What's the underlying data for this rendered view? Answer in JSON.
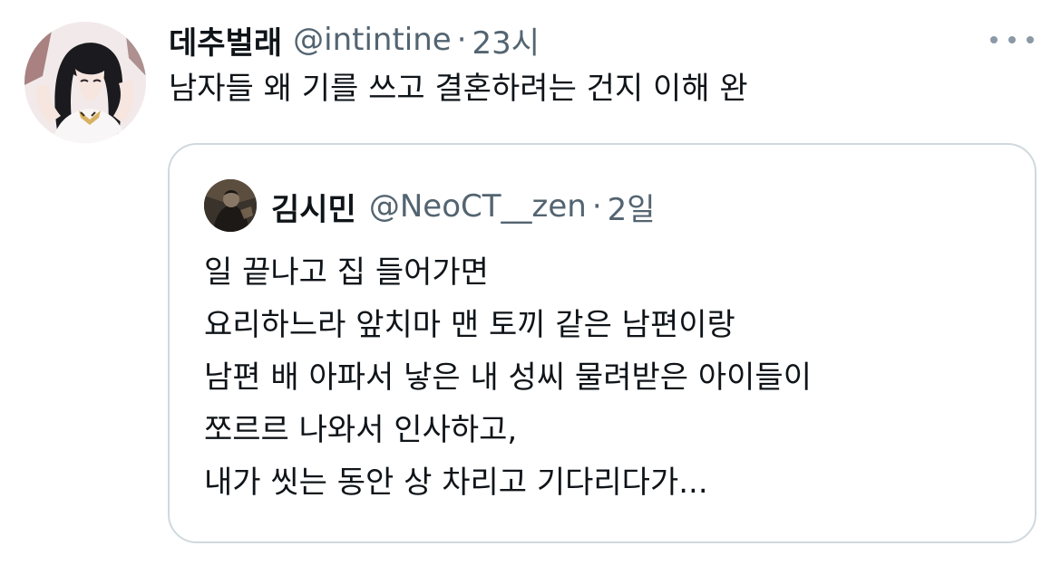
{
  "tweet": {
    "display_name": "데추벌래",
    "handle": "@intintine",
    "separator": "·",
    "time": "23시",
    "text": "남자들 왜 기를 쓰고 결혼하려는 건지 이해 완"
  },
  "quoted_tweet": {
    "display_name": "김시민",
    "handle": "@NeoCT__zen",
    "separator": "·",
    "time": "2일",
    "lines": [
      "일 끝나고 집 들어가면",
      "요리하느라 앞치마 맨 토끼 같은 남편이랑",
      "남편 배 아파서 낳은 내 성씨 물려받은 아이들이",
      "쪼르르 나와서 인사하고,",
      "내가 씻는 동안 상 차리고 기다리다가..."
    ]
  },
  "icons": {
    "more": "more-horizontal-icon"
  },
  "colors": {
    "text_primary": "#0f1419",
    "text_secondary": "#536471",
    "border": "#cfd9de",
    "more_dots": "#8b98a5"
  }
}
